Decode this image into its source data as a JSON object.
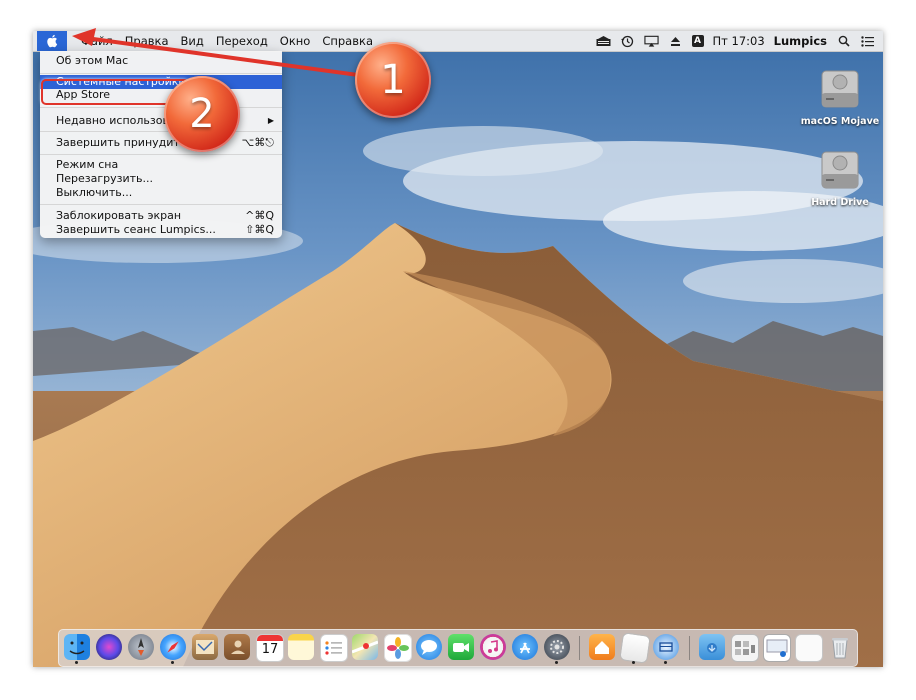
{
  "menubar": {
    "apple_icon": "apple-logo-icon",
    "items": [
      "Файл",
      "Правка",
      "Вид",
      "Переход",
      "Окно",
      "Справка"
    ],
    "status_icons": [
      "eject-drive-icon",
      "time-machine-icon",
      "airplay-icon",
      "eject-icon",
      "input-source-icon"
    ],
    "input_source_letter": "A",
    "clock": "Пт 17:03",
    "user": "Lumpics",
    "spotlight_icon": "search-icon",
    "notification_icon": "list-icon"
  },
  "apple_menu": {
    "items": [
      {
        "label": "Об этом Mac",
        "shortcut": ""
      },
      {
        "label": "Системные настройки...",
        "shortcut": "",
        "highlighted": true
      },
      {
        "label": "App Store",
        "shortcut": ""
      },
      {
        "label": "Недавно использован",
        "shortcut": "▶"
      },
      {
        "label": "Завершить принудитель",
        "shortcut": "⌥⌘⎋"
      },
      {
        "label": "Режим сна",
        "shortcut": ""
      },
      {
        "label": "Перезагрузить...",
        "shortcut": ""
      },
      {
        "label": "Выключить...",
        "shortcut": ""
      },
      {
        "label": "Заблокировать экран",
        "shortcut": "^⌘Q"
      },
      {
        "label": "Завершить сеанс Lumpics...",
        "shortcut": "⇧⌘Q"
      }
    ]
  },
  "desktop": {
    "disks": [
      "macOS Mojave",
      "Hard Drive"
    ]
  },
  "callouts": [
    "1",
    "2"
  ],
  "dock": {
    "apps": [
      "finder-icon",
      "siri-icon",
      "launchpad-icon",
      "safari-icon",
      "mail-icon",
      "contacts-icon",
      "calendar-icon",
      "notes-icon",
      "reminders-icon",
      "maps-icon",
      "photos-icon",
      "messages-icon",
      "facetime-icon",
      "music-icon",
      "app-store-icon",
      "system-preferences-icon",
      "home-icon",
      "document-icon",
      "network-icon",
      "folder-icon",
      "screenshot-icon",
      "preview-icon",
      "document-stack-icon",
      "trash-icon"
    ],
    "calendar_day": "17"
  },
  "colors": {
    "selection_blue": "#2d62d6",
    "callout_red": "#e0342a"
  }
}
